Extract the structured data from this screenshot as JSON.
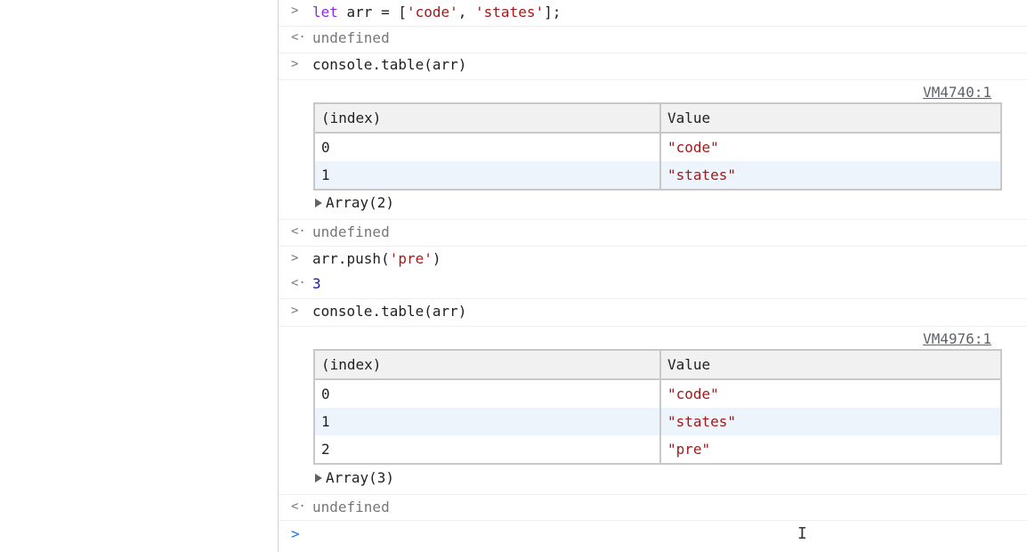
{
  "console": {
    "entries": [
      {
        "prompt": ">",
        "tokens": {
          "kw": "let",
          "mid": " arr = [",
          "s1": "'code'",
          "sep": ", ",
          "s2": "'states'",
          "end": "];"
        }
      },
      {
        "prompt": "<·",
        "text": "undefined"
      },
      {
        "prompt": ">",
        "text": "console.table(arr)"
      },
      {
        "source": "VM4740:1",
        "table": {
          "headers": [
            "(index)",
            "Value"
          ],
          "rows": [
            [
              "0",
              "\"code\""
            ],
            [
              "1",
              "\"states\""
            ]
          ]
        },
        "array_label": "Array(2)"
      },
      {
        "prompt": "<·",
        "text": "undefined"
      },
      {
        "prompt": ">",
        "tokens": {
          "pre": "arr.push(",
          "s": "'pre'",
          "post": ")"
        }
      },
      {
        "prompt": "<·",
        "text": "3"
      },
      {
        "prompt": ">",
        "text": "console.table(arr)"
      },
      {
        "source": "VM4976:1",
        "table": {
          "headers": [
            "(index)",
            "Value"
          ],
          "rows": [
            [
              "0",
              "\"code\""
            ],
            [
              "1",
              "\"states\""
            ],
            [
              "2",
              "\"pre\""
            ]
          ]
        },
        "array_label": "Array(3)"
      },
      {
        "prompt": "<·",
        "text": "undefined"
      },
      {
        "prompt": ">"
      }
    ]
  },
  "colors": {
    "keyword": "#8a2be2",
    "string": "#a11a1a",
    "number": "#1a1aa6",
    "muted": "#777777",
    "active_prompt": "#1a73e8"
  },
  "icons": {
    "input_prompt": "chevron-right-icon",
    "result_prompt": "return-arrow-icon",
    "expand": "triangle-right-icon",
    "cursor": "text-cursor-icon"
  }
}
